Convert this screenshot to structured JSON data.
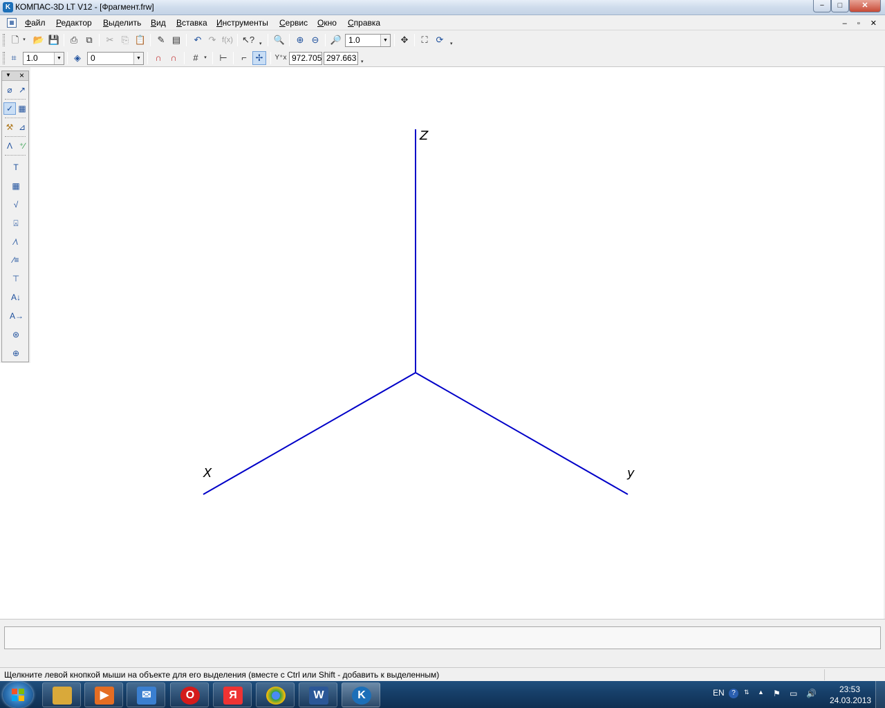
{
  "window": {
    "title": "КОМПАС-3D LT V12 - [Фрагмент.frw]",
    "app_icon": "kompas-icon",
    "controls": {
      "minimize": "−",
      "maximize": "□",
      "close": "✕"
    }
  },
  "menu": {
    "items": [
      "Файл",
      "Редактор",
      "Выделить",
      "Вид",
      "Вставка",
      "Инструменты",
      "Сервис",
      "Окно",
      "Справка"
    ],
    "mdi_controls": "– ▫ ✕"
  },
  "toolbar_standard": {
    "zoom_value": "1.0",
    "icons": [
      "new-document-icon",
      "open-icon",
      "save-icon",
      "print-preview-icon",
      "print-icon",
      "cut-icon",
      "copy-icon",
      "paste-icon",
      "properties-icon",
      "manager-icon",
      "undo-icon",
      "redo-icon",
      "function-icon",
      "help-pointer-icon",
      "zoom-window-icon",
      "zoom-in-icon",
      "zoom-out-icon",
      "zoom-scale-icon",
      "pan-icon",
      "show-all-icon",
      "refresh-icon"
    ]
  },
  "toolbar_current_state": {
    "step_value": "1.0",
    "layer_value": "0",
    "coord_x": "972.705",
    "coord_y": "297.663",
    "icons": [
      "cursor-step-icon",
      "layer-icon",
      "snap-magnet-icon",
      "local-snap-icon",
      "grid-icon",
      "local-cs-icon",
      "ortho-icon",
      "round-icon",
      "parametric-icon",
      "coordinates-icon"
    ]
  },
  "left_toolbar": {
    "icons": [
      "geometry-icon",
      "dimensions-icon",
      "designations-icon",
      "edit-icon",
      "parametrization-icon",
      "measure-icon",
      "select-icon",
      "spec-icon",
      "reports-icon",
      "insert-icon",
      "text-icon",
      "table-icon",
      "roughness-icon",
      "base-icon",
      "leader-icon",
      "position-icon",
      "mark-icon",
      "arrow-view-icon",
      "section-icon",
      "view-icon",
      "centermark-icon"
    ]
  },
  "drawing": {
    "axis_labels": {
      "z": "Z",
      "x": "X",
      "y": "y"
    },
    "line_color": "#0000c8"
  },
  "status": {
    "message": "Щелкните левой кнопкой мыши на объекте для его выделения (вместе с Ctrl или Shift - добавить к выделенным)"
  },
  "taskbar": {
    "apps": [
      {
        "name": "explorer-icon",
        "color": "#d9a93a",
        "glyph": ""
      },
      {
        "name": "media-player-icon",
        "color": "#e46d23",
        "glyph": "▶"
      },
      {
        "name": "mail-icon",
        "color": "#3a7fd0",
        "glyph": "✉"
      },
      {
        "name": "opera-icon",
        "color": "#d41b1b",
        "glyph": "O"
      },
      {
        "name": "yandex-browser-icon",
        "color": "#e33",
        "glyph": "Я"
      },
      {
        "name": "chrome-icon",
        "color": "#2e9e48",
        "glyph": "●"
      },
      {
        "name": "word-icon",
        "color": "#2b5797",
        "glyph": "W"
      },
      {
        "name": "kompas-taskbar-icon",
        "color": "#1c6fb8",
        "glyph": "K"
      }
    ],
    "language": "EN",
    "time": "23:53",
    "date": "24.03.2013"
  }
}
